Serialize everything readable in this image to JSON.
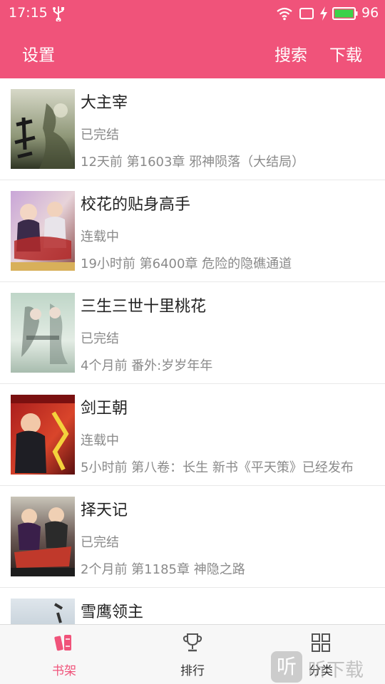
{
  "status_bar": {
    "time": "17:15",
    "battery": "96",
    "icons": [
      "usb-icon",
      "wifi-icon",
      "screen-icon",
      "charging-bolt-icon",
      "battery-icon"
    ]
  },
  "header": {
    "settings": "设置",
    "search": "搜索",
    "download": "下载",
    "accent_color": "#f0537a"
  },
  "books": [
    {
      "title": "大主宰",
      "status": "已完结",
      "update": "12天前 第1603章 邪神陨落（大结局）"
    },
    {
      "title": "校花的贴身高手",
      "status": "连载中",
      "update": "19小时前 第6400章 危险的隐礁通道"
    },
    {
      "title": "三生三世十里桃花",
      "status": "已完结",
      "update": "4个月前 番外:岁岁年年"
    },
    {
      "title": "剑王朝",
      "status": "连载中",
      "update": "5小时前 第八卷：长生 新书《平天策》已经发布"
    },
    {
      "title": "择天记",
      "status": "已完结",
      "update": "2个月前 第1185章 神隐之路"
    },
    {
      "title": "雪鹰领主",
      "status": "",
      "update": ""
    }
  ],
  "tabs": {
    "shelf": "书架",
    "rank": "排行",
    "category": "分类",
    "active": "书架"
  },
  "watermark": {
    "badge": "听",
    "text": "听下载"
  }
}
